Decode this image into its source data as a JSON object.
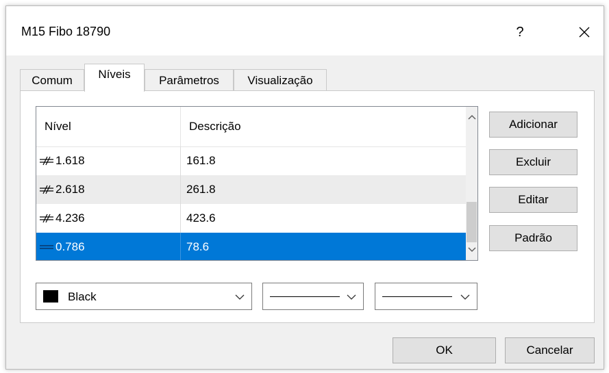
{
  "window": {
    "title": "M15 Fibo 18790",
    "help": "?",
    "close_icon": "close-icon"
  },
  "tabs": [
    {
      "label": "Comum",
      "active": false
    },
    {
      "label": "Níveis",
      "active": true
    },
    {
      "label": "Parâmetros",
      "active": false
    },
    {
      "label": "Visualização",
      "active": false
    }
  ],
  "levels_table": {
    "columns": [
      "Nível",
      "Descrição"
    ],
    "rows": [
      {
        "level": "1.618",
        "description": "161.8",
        "selected": false
      },
      {
        "level": "2.618",
        "description": "261.8",
        "selected": false
      },
      {
        "level": "4.236",
        "description": "423.6",
        "selected": false
      },
      {
        "level": "0.786",
        "description": "78.6",
        "selected": true
      }
    ],
    "level_icon": "fibo-level-icon",
    "scroll_position": 0.85
  },
  "side_buttons": {
    "add": "Adicionar",
    "delete": "Excluir",
    "edit": "Editar",
    "default": "Padrão"
  },
  "style_controls": {
    "color": {
      "label": "Black",
      "value": "#000000"
    },
    "line_style": "solid",
    "line_width": "thin"
  },
  "footer": {
    "ok": "OK",
    "cancel": "Cancelar"
  },
  "colors": {
    "selection": "#0078d7",
    "dialog_bg": "#f0f0f0",
    "button_bg": "#e1e1e1"
  }
}
